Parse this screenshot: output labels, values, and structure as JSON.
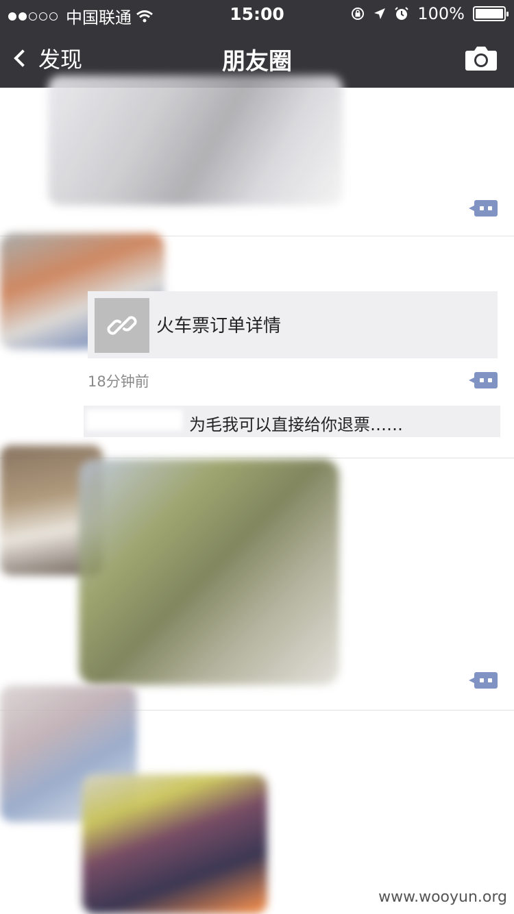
{
  "status_bar": {
    "carrier": "中国联通",
    "time": "15:00",
    "battery": "100%"
  },
  "nav": {
    "back_label": "发现",
    "title": "朋友圈"
  },
  "post": {
    "link_title": "火车票订单详情",
    "time": "18分钟前",
    "comment_text": "为毛我可以直接给你退票……"
  },
  "watermark": "www.wooyun.org"
}
